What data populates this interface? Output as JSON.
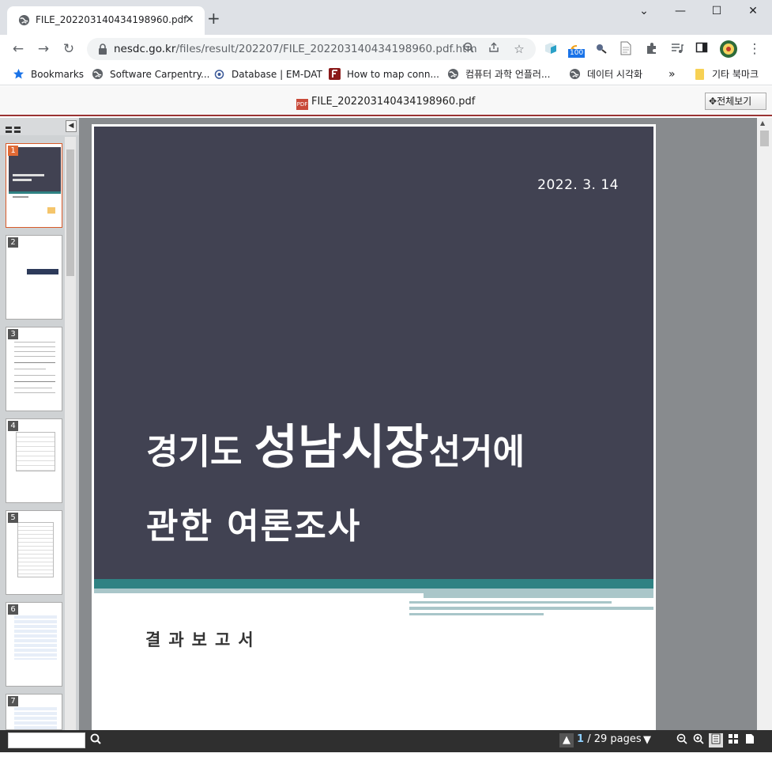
{
  "browser": {
    "tab_title": "FILE_202203140434198960.pdf",
    "new_tab": "+",
    "window_controls": {
      "minimize": "—",
      "maximize": "☐",
      "close": "✕",
      "tab_search": "⌄"
    },
    "url_host": "nesdc.go.kr",
    "url_path": "/files/result/202207/FILE_202203140434198960.pdf.htm",
    "extension_badge": "100"
  },
  "bookmarks": [
    {
      "label": "Bookmarks",
      "icon": "star-icon"
    },
    {
      "label": "Software Carpentry...",
      "icon": "globe-icon"
    },
    {
      "label": "Database | EM-DAT",
      "icon": "emdat-icon"
    },
    {
      "label": "How to map conn...",
      "icon": "f-icon"
    },
    {
      "label": "컴퓨터 과학 언플러...",
      "icon": "globe-icon"
    },
    {
      "label": "데이터 시각화",
      "icon": "globe-icon"
    },
    {
      "label": "기타 북마크",
      "icon": "folder-icon"
    }
  ],
  "bookmarks_more": "»",
  "pdf_viewer": {
    "file_name": "FILE_202203140434198960.pdf",
    "file_icon_text": "PDF",
    "fullview_label": "전체보기",
    "current_page": "1",
    "page_info": "/ 29 pages",
    "thumbnails": [
      "1",
      "2",
      "3",
      "4",
      "5",
      "6",
      "7"
    ]
  },
  "document": {
    "date": "2022. 3. 14",
    "title_line1_a": "경기도 ",
    "title_line1_b": "성남시장",
    "title_line1_c": "선거에",
    "title_line2": "관한 여론조사",
    "subtitle": "결과보고서"
  },
  "colors": {
    "cover": "#414252",
    "teal": "#2f8283",
    "active_thumb": "#e06a35"
  }
}
